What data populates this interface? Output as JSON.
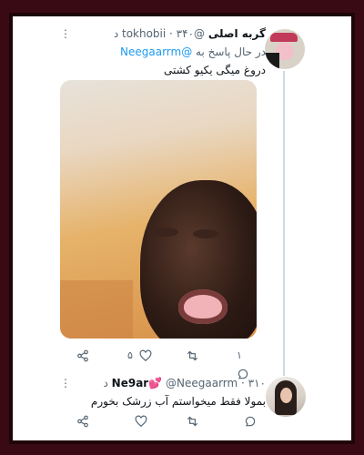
{
  "tweet1": {
    "display_name": "گربه اصلی",
    "handle": "@tokhobii",
    "time": "۳۴۰ د",
    "replying_prefix": "در حال پاسخ به",
    "replying_to": "@Neegaarrm",
    "text": "دروغ میگی یکیو کشتی",
    "reply_count": "۱",
    "like_count": "۵"
  },
  "tweet2": {
    "display_name": "Ne9ar💕",
    "handle": "@Neegaarrm",
    "time": "۳۱۰ د",
    "text": "بمولا فقط میخواستم آب زرشک بخورم"
  },
  "colors": {
    "accent": "#1d9bf0",
    "background_border": "#1e0507",
    "secondary_text": "#536471"
  },
  "icons": [
    "more-icon",
    "reply-icon",
    "retweet-icon",
    "like-icon",
    "share-icon"
  ]
}
